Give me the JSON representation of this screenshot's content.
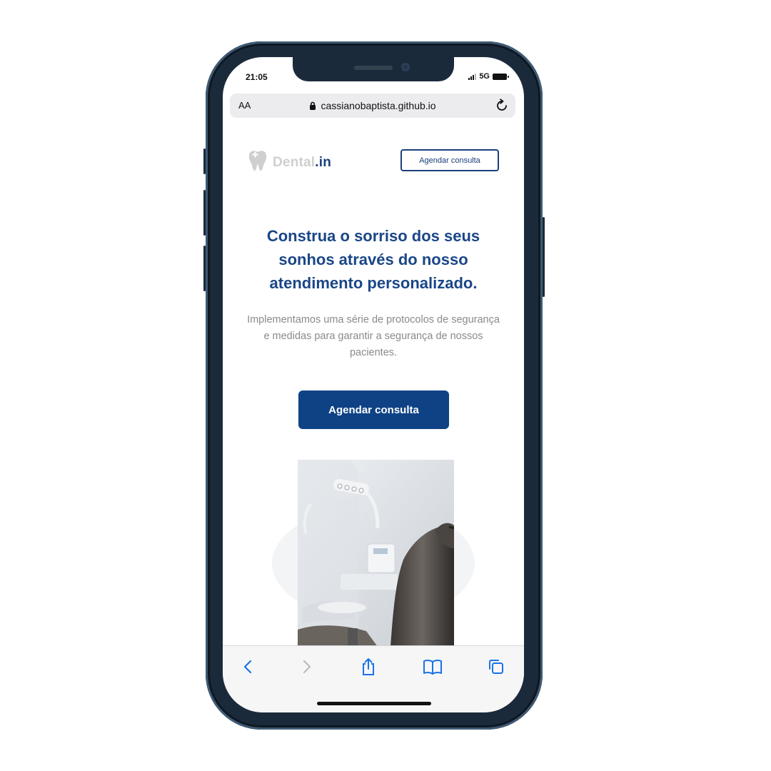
{
  "status_bar": {
    "time": "21:05",
    "network": "5G"
  },
  "browser": {
    "text_size_label": "AA",
    "domain": "cassianobaptista.github.io",
    "icons": {
      "lock": "lock-icon",
      "reload": "reload-icon",
      "back": "chevron-left-icon",
      "forward": "chevron-right-icon",
      "share": "share-icon",
      "bookmarks": "book-icon",
      "tabs": "tabs-icon"
    }
  },
  "site": {
    "logo": {
      "icon": "tooth-icon",
      "name_main": "Dental",
      "name_suffix": ".in"
    },
    "header_cta_label": "Agendar consulta",
    "headline": "Construa o sorriso dos seus sonhos através do nosso atendimento personalizado.",
    "subtext": "Implementamos uma série de protocolos de segurança e medidas para garantir a segurança de nossos pacientes.",
    "main_cta_label": "Agendar consulta",
    "hero_image": "dental-chair-photo"
  },
  "colors": {
    "brand_blue": "#0e4285",
    "headline_blue": "#1a4687",
    "logo_gray": "#cfcfcf",
    "phone_frame": "#1b2a3b",
    "ios_link_blue": "#1a73e8"
  }
}
